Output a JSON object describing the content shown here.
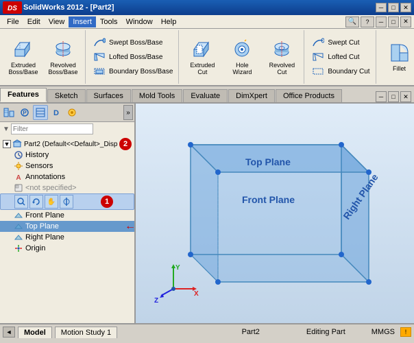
{
  "titleBar": {
    "title": "SolidWorks 2012 - [Part2]",
    "logo": "DS SOLIDWORKS",
    "controls": [
      "minimize",
      "restore",
      "close"
    ]
  },
  "menuBar": {
    "items": [
      "File",
      "Edit",
      "View",
      "Insert",
      "Tools",
      "Window",
      "Help"
    ]
  },
  "toolbar": {
    "groups": [
      {
        "name": "boss-base",
        "buttons": [
          {
            "id": "extruded-boss",
            "label": "Extruded\nBoss/Base",
            "icon": "extrude"
          },
          {
            "id": "revolved-boss",
            "label": "Revolved\nBoss/Base",
            "icon": "revolve"
          }
        ]
      },
      {
        "name": "boss-sub",
        "items": [
          {
            "id": "swept-boss",
            "label": "Swept Boss/Base"
          },
          {
            "id": "lofted-boss",
            "label": "Lofted Boss/Base"
          },
          {
            "id": "boundary-boss",
            "label": "Boundary Boss/Base"
          }
        ]
      },
      {
        "name": "cut",
        "buttons": [
          {
            "id": "extruded-cut",
            "label": "Extruded\nCut",
            "icon": "extrude-cut"
          },
          {
            "id": "hole-wizard",
            "label": "Hole\nWizard",
            "icon": "hole"
          },
          {
            "id": "revolved-cut",
            "label": "Revolved\nCut",
            "icon": "revolve-cut"
          }
        ]
      },
      {
        "name": "cut-sub",
        "items": [
          {
            "id": "swept-cut",
            "label": "Swept Cut"
          },
          {
            "id": "lofted-cut",
            "label": "Lofted Cut"
          },
          {
            "id": "boundary-cut",
            "label": "Boundary Cut"
          }
        ]
      },
      {
        "name": "fillet",
        "buttons": [
          {
            "id": "fillet",
            "label": "Fillet",
            "icon": "fillet"
          }
        ]
      }
    ],
    "fillet_label": "Fillet"
  },
  "tabs": {
    "items": [
      "Features",
      "Sketch",
      "Surfaces",
      "Mold Tools",
      "Evaluate",
      "DimXpert",
      "Office Products"
    ]
  },
  "sidebar": {
    "filterPlaceholder": "Filter",
    "tree": {
      "root": "Part2 (Default<<Default>_Disp",
      "children": [
        {
          "id": "history",
          "label": "History",
          "icon": "history"
        },
        {
          "id": "sensors",
          "label": "Sensors",
          "icon": "sensor"
        },
        {
          "id": "annotations",
          "label": "Annotations",
          "icon": "annotation"
        },
        {
          "id": "material",
          "label": "<not specified>",
          "icon": "material"
        },
        {
          "id": "front-plane",
          "label": "Front Plane",
          "icon": "plane",
          "selected": false
        },
        {
          "id": "top-plane",
          "label": "Top Plane",
          "icon": "plane",
          "selected": true
        },
        {
          "id": "right-plane",
          "label": "Right Plane",
          "icon": "plane"
        },
        {
          "id": "origin",
          "label": "Origin",
          "icon": "origin"
        }
      ]
    },
    "badge1": "1",
    "badge2": "2"
  },
  "viewport": {
    "planes": [
      {
        "id": "front-plane",
        "label": "Front Plane"
      },
      {
        "id": "top-plane",
        "label": "Top Plane"
      },
      {
        "id": "right-plane",
        "label": "Right Plane"
      }
    ],
    "axes": [
      "X",
      "Y",
      "Z"
    ]
  },
  "statusBar": {
    "tabs": [
      "Model",
      "Motion Study 1"
    ],
    "activeTab": "Model",
    "partName": "Part2",
    "editingStatus": "Editing Part",
    "units": "MMGS",
    "warningIcon": "warning"
  },
  "bottomBar": {
    "partName": "Part2",
    "status": "Editing Part",
    "units": "MMGS"
  }
}
